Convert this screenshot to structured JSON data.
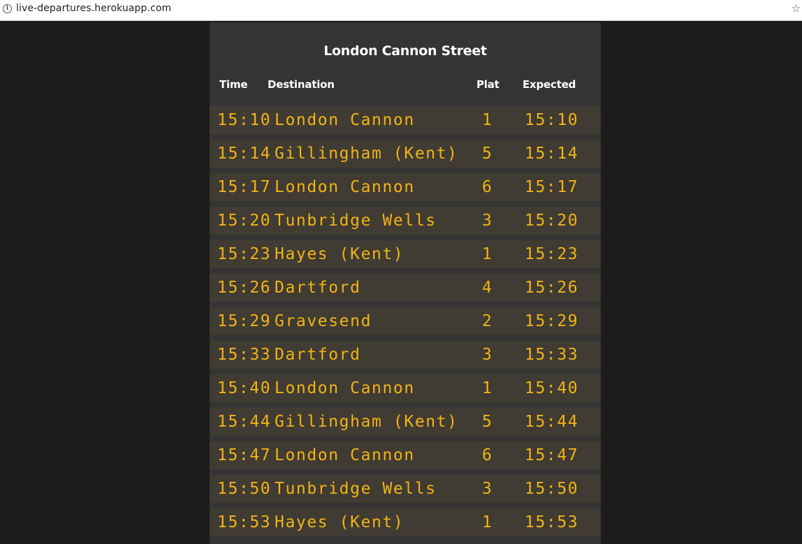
{
  "browser": {
    "url": "live-departures.herokuapp.com",
    "info_icon": "info-icon",
    "star_icon": "bookmark-star-icon"
  },
  "board": {
    "station": "London Cannon Street",
    "headers": {
      "time": "Time",
      "destination": "Destination",
      "platform": "Plat",
      "expected": "Expected"
    },
    "rows": [
      {
        "time": "15:10",
        "destination": "London Cannon",
        "platform": "1",
        "expected": "15:10"
      },
      {
        "time": "15:14",
        "destination": "Gillingham (Kent)",
        "platform": "5",
        "expected": "15:14"
      },
      {
        "time": "15:17",
        "destination": "London Cannon",
        "platform": "6",
        "expected": "15:17"
      },
      {
        "time": "15:20",
        "destination": "Tunbridge Wells",
        "platform": "3",
        "expected": "15:20"
      },
      {
        "time": "15:23",
        "destination": "Hayes (Kent)",
        "platform": "1",
        "expected": "15:23"
      },
      {
        "time": "15:26",
        "destination": "Dartford",
        "platform": "4",
        "expected": "15:26"
      },
      {
        "time": "15:29",
        "destination": "Gravesend",
        "platform": "2",
        "expected": "15:29"
      },
      {
        "time": "15:33",
        "destination": "Dartford",
        "platform": "3",
        "expected": "15:33"
      },
      {
        "time": "15:40",
        "destination": "London Cannon",
        "platform": "1",
        "expected": "15:40"
      },
      {
        "time": "15:44",
        "destination": "Gillingham (Kent)",
        "platform": "5",
        "expected": "15:44"
      },
      {
        "time": "15:47",
        "destination": "London Cannon",
        "platform": "6",
        "expected": "15:47"
      },
      {
        "time": "15:50",
        "destination": "Tunbridge Wells",
        "platform": "3",
        "expected": "15:50"
      },
      {
        "time": "15:53",
        "destination": "Hayes (Kent)",
        "platform": "1",
        "expected": "15:53"
      }
    ]
  },
  "colors": {
    "page_background": "#1c1c1c",
    "board_background": "#343434",
    "row_background": "#403b33",
    "led_text": "#f2b415",
    "header_text": "#ffffff"
  }
}
